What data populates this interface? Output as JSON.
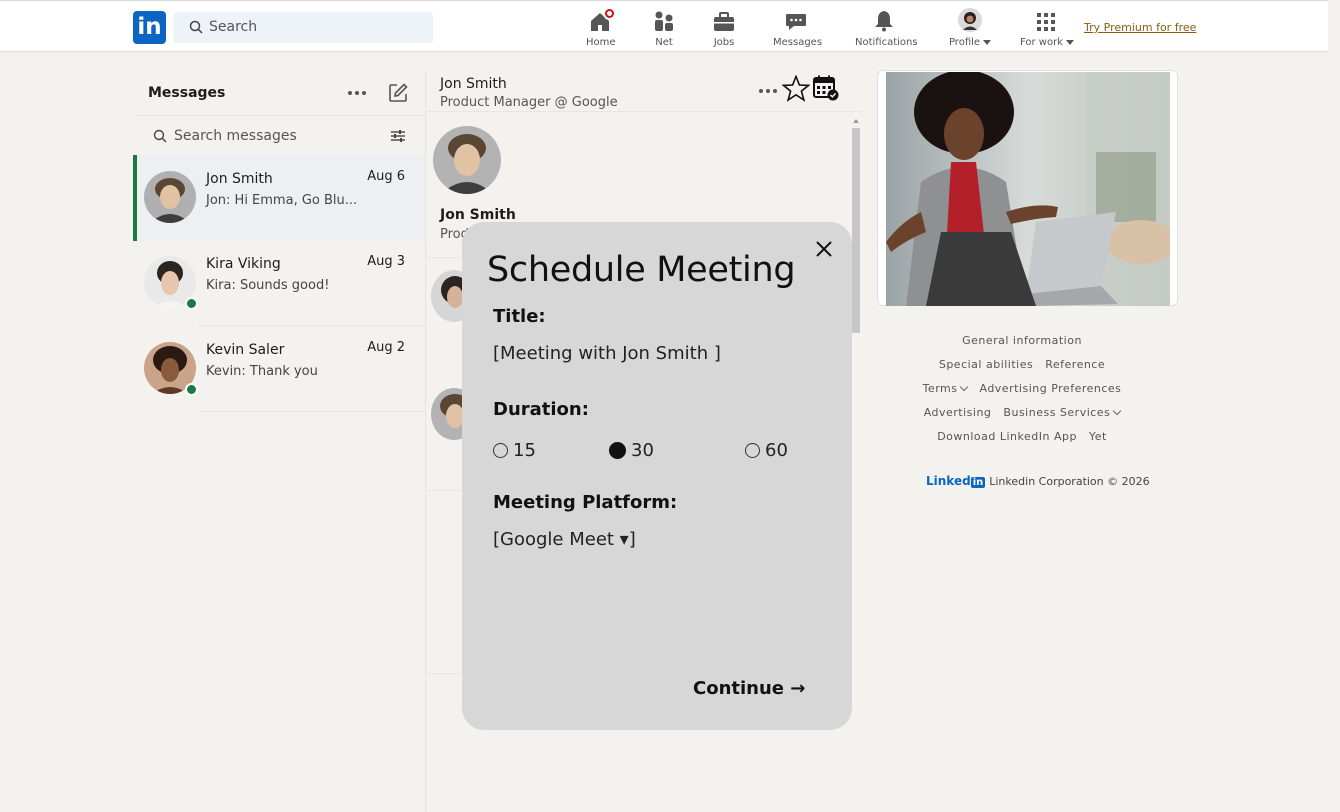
{
  "nav": {
    "search_placeholder": "Search",
    "items": [
      {
        "label": "Home",
        "icon": "home-icon"
      },
      {
        "label": "Net",
        "icon": "network-icon"
      },
      {
        "label": "Jobs",
        "icon": "briefcase-icon"
      },
      {
        "label": "Messages",
        "icon": "chat-icon"
      },
      {
        "label": "Notifications",
        "icon": "bell-icon"
      },
      {
        "label": "Profile",
        "icon": "avatar"
      },
      {
        "label": "For work",
        "icon": "grid-icon"
      }
    ],
    "premium": "Try Premium for free",
    "logo": "in"
  },
  "messaging": {
    "title": "Messages",
    "search_placeholder": "Search messages",
    "conversations": [
      {
        "name": "Jon Smith",
        "date": "Aug 6",
        "preview": "Jon:  Hi Emma, Go Blu..."
      },
      {
        "name": "Kira Viking",
        "date": "Aug 3",
        "preview": "Kira:  Sounds good!"
      },
      {
        "name": "Kevin Saler",
        "date": "Aug 2",
        "preview": "Kevin:  Thank you"
      }
    ]
  },
  "thread": {
    "name": "Jon Smith",
    "subtitle": "Product Manager @ Google",
    "profile_name": "Jon Smith",
    "profile_sub": "Prod"
  },
  "modal": {
    "title": "Schedule Meeting",
    "title_label": "Title:",
    "title_value": "[Meeting with Jon Smith              ]",
    "duration_label": "Duration:",
    "durations": [
      "15",
      "30",
      "60"
    ],
    "selected_duration": "30",
    "platform_label": "Meeting Platform:",
    "platform_value": "[Google Meet ▾]",
    "continue": "Continue →"
  },
  "footer": {
    "row1": [
      "General information"
    ],
    "row2": [
      "Special abilities",
      "Reference"
    ],
    "row3": [
      "Terms",
      "Advertising Preferences"
    ],
    "row4": [
      "Advertising",
      "Business Services"
    ],
    "row5": [
      "Download LinkedIn App",
      "Yet"
    ],
    "brand": "Linked",
    "brand_in": "in",
    "copyright": "Linkedin Corporation © 2026"
  },
  "colors": {
    "brand": "#0a66c2",
    "online": "#1a7a3f",
    "active_border": "#1a7a3f",
    "badge": "#cc1016"
  }
}
